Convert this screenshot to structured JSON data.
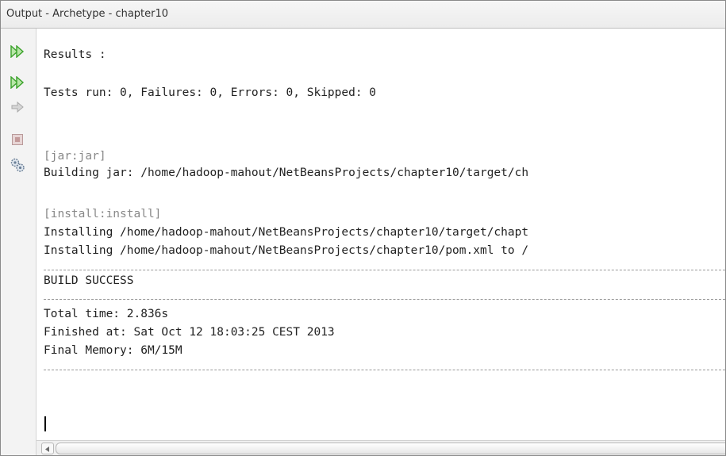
{
  "window": {
    "title": "Output - Archetype - chapter10"
  },
  "toolbar": [
    {
      "name": "rerun-icon",
      "color": "#3aa12a"
    },
    {
      "name": "rerun-with-goals-icon",
      "color": "#3aa12a"
    },
    {
      "name": "resume-arrow-icon",
      "color": "#c0c0c0"
    },
    {
      "name": "stop-icon",
      "color": "#c8a0a0"
    },
    {
      "name": "settings-icon",
      "color": "#6b7f96"
    }
  ],
  "output": {
    "results_line": "Results :",
    "tests_line": "Tests run: 0, Failures: 0, Errors: 0, Skipped: 0",
    "jar_goal": "[jar:jar]",
    "building_jar": "Building jar: /home/hadoop-mahout/NetBeansProjects/chapter10/target/ch",
    "install_goal": "[install:install]",
    "installing_1": "Installing /home/hadoop-mahout/NetBeansProjects/chapter10/target/chapt",
    "installing_2": "Installing /home/hadoop-mahout/NetBeansProjects/chapter10/pom.xml to /",
    "build_status": "BUILD SUCCESS",
    "total_time": "Total time: 2.836s",
    "finished_at": "Finished at: Sat Oct 12 18:03:25 CEST 2013",
    "final_memory": "Final Memory: 6M/15M"
  }
}
